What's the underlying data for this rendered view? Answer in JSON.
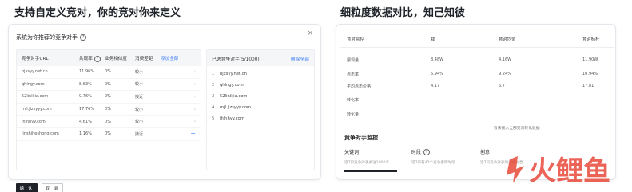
{
  "headings": {
    "left": "支持自定义竞对，你的竞对你来定义",
    "right": "细粒度数据对比，知己知彼"
  },
  "modal": {
    "title": "系统为你推荐的竞争对手",
    "close": "×",
    "table": {
      "headers": [
        "竞争对手URL",
        "共现率",
        "业务相似度",
        "消费差距"
      ],
      "add_all": "添加全部",
      "rows": [
        {
          "url": "bjxsyy.net.cn",
          "cooccur": "11.96%",
          "similarity": "0%",
          "gap": "较小"
        },
        {
          "url": "qhlngy.com",
          "cooccur": "8.63%",
          "similarity": "0%",
          "gap": "较小"
        },
        {
          "url": "52linlijia.com",
          "cooccur": "9.76%",
          "similarity": "0%",
          "gap": "接近"
        },
        {
          "url": "mjl.jizsyyy.com",
          "cooccur": "17.76%",
          "similarity": "0%",
          "gap": "较小"
        },
        {
          "url": "jhlnhyy.com",
          "cooccur": "4.61%",
          "similarity": "0%",
          "gap": "较小"
        },
        {
          "url": "jinshiheshong.com",
          "cooccur": "1.16%",
          "similarity": "0%",
          "gap": "接近"
        }
      ]
    },
    "selected": {
      "title": "已选竞争对手(5/1000)",
      "delete_all": "删除全部",
      "items": [
        "bjxsyy.net.cn",
        "qhlngy.com",
        "52linlijia.com",
        "mjl.jizsyyy.com",
        "jhlnhyy.com"
      ]
    },
    "ok_label": "确 认",
    "cancel_label": "取 消"
  },
  "compare": {
    "headers": [
      "竞对监控",
      "我",
      "竞对均值",
      "竞对标杆"
    ],
    "rows": [
      {
        "label": "展现量",
        "me": "8.48W",
        "avg": "4.16W",
        "best": "11.90W"
      },
      {
        "label": "点击率",
        "me": "5.94%",
        "avg": "9.24%",
        "best": "10.94%"
      },
      {
        "label": "平均点击价格",
        "me": "4.17",
        "avg": "6.7",
        "best": "17.81"
      },
      {
        "label": "转化率",
        "me": "",
        "avg": "",
        "best": ""
      },
      {
        "label": "转化量",
        "me": "",
        "avg": "",
        "best": ""
      }
    ],
    "no_data": "暂未接入全部竞对转化数据"
  },
  "monitor": {
    "title": "竞争对手监控",
    "tabs": [
      {
        "label": "关键词",
        "sub": "近7日竞争对手关注1000个"
      },
      {
        "label": "时段",
        "sub": "近7日有42个竞争者的时段"
      },
      {
        "label": "创意",
        "sub": "近7日竞争对手的高频创意"
      }
    ]
  },
  "watermark": "火鲤鱼"
}
